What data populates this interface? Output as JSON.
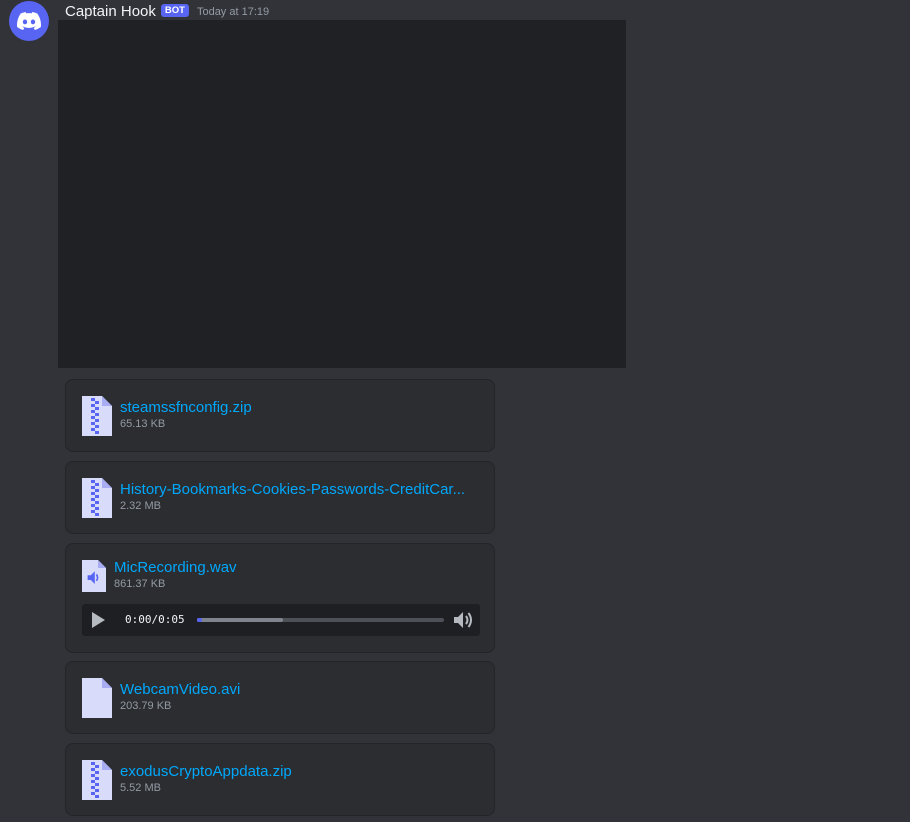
{
  "message": {
    "author": "Captain Hook",
    "bot_tag": "BOT",
    "timestamp": "Today at 17:19"
  },
  "attachments": [
    {
      "name": "steamssfnconfig.zip",
      "size": "65.13 KB",
      "icon": "zip-file-icon"
    },
    {
      "name": "History-Bookmarks-Cookies-Passwords-CreditCar...",
      "size": "2.32 MB",
      "icon": "zip-file-icon"
    },
    {
      "name": "MicRecording.wav",
      "size": "861.37 KB",
      "icon": "audio-file-icon"
    },
    {
      "name": "WebcamVideo.avi",
      "size": "203.79 KB",
      "icon": "generic-file-icon"
    },
    {
      "name": "exodusCryptoAppdata.zip",
      "size": "5.52 MB",
      "icon": "zip-file-icon"
    }
  ],
  "audio_player": {
    "current_time": "0:00",
    "separator": "/",
    "duration": "0:05",
    "played_fraction": 0.02,
    "buffered_fraction": 0.35
  },
  "colors": {
    "background": "#313338",
    "link": "#00a8fc",
    "accent": "#5865f2",
    "file_icon": "#d9dbfb"
  }
}
